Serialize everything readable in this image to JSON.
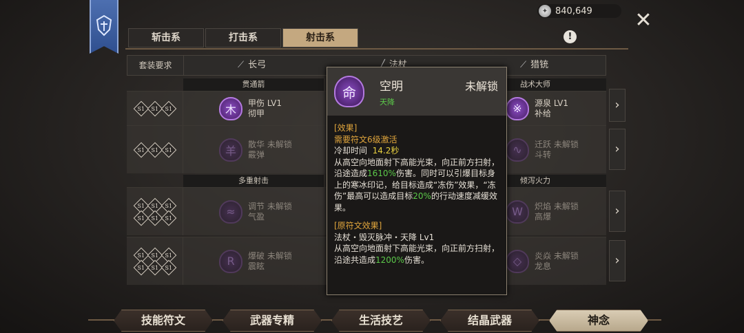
{
  "currency": {
    "icon": "silver-coin-icon",
    "amount": "840,649"
  },
  "tabs": [
    {
      "label": "斩击系",
      "active": false
    },
    {
      "label": "打击系",
      "active": false
    },
    {
      "label": "射击系",
      "active": true
    }
  ],
  "filter": {
    "label": "套装要求",
    "weapons": [
      {
        "icon": "bow-icon",
        "label": "长弓"
      },
      {
        "icon": "staff-icon",
        "label": "法杖"
      },
      {
        "icon": "musket-icon",
        "label": "猎铳"
      }
    ]
  },
  "groups": {
    "g1_left": "贯通箭",
    "g1_right": "战术大师",
    "g2_left": "多重射击",
    "g2_right": "倾泻火力"
  },
  "rows": [
    {
      "slots": [
        "S1",
        "S1",
        "S1"
      ],
      "left": {
        "name": "甲伤 LV1",
        "desc": "彻甲"
      },
      "right": {
        "name": "源泉 LV1",
        "desc": "补给"
      }
    },
    {
      "slots": [
        "S1",
        "S1",
        "S1"
      ],
      "left": {
        "name": "散华 未解锁",
        "desc": "霰弹"
      },
      "right": {
        "name": "迁跃 未解锁",
        "desc": "斗转"
      }
    },
    {
      "slots": [
        "S1",
        "S1",
        "S1",
        "S1",
        "S1",
        "S1"
      ],
      "left": {
        "name": "调节 未解锁",
        "desc": "气盈"
      },
      "right": {
        "name": "炽焰 未解锁",
        "desc": "高爆"
      }
    },
    {
      "slots": [
        "S1",
        "S1",
        "S1",
        "S1",
        "S1",
        "S1"
      ],
      "left": {
        "name": "爆破 未解锁",
        "desc": "震眩"
      },
      "right": {
        "name": "炎焱 未解锁",
        "desc": "龙息"
      }
    }
  ],
  "tooltip": {
    "name": "空明",
    "subtitle": "天降",
    "status": "未解锁",
    "effect_header": "[效果]",
    "requirement": "需要符文6级激活",
    "cooldown_label": "冷却时间",
    "cooldown_value": "14.2秒",
    "effect_pre": "从高空向地面射下高能光束，向正前方扫射，沿途造成",
    "effect_pct1": "1610%",
    "effect_mid": "伤害。同时可以引爆目标身上的寒冰印记，给目标造成“冻伤”效果，“冻伤”最高可以造成目标",
    "effect_pct2": "20%",
    "effect_post": "的行动速度减缓效果。",
    "orig_header": "[原符文效果]",
    "orig_source": "法杖・毁灭脉冲・天降 Lv1",
    "orig_pre": "从高空向地面射下高能光束，向正前方扫射，沿途共造成",
    "orig_pct": "1200%",
    "orig_post": "伤害。"
  },
  "bottom_nav": [
    {
      "label": "技能符文",
      "active": false
    },
    {
      "label": "武器专精",
      "active": false
    },
    {
      "label": "生活技艺",
      "active": false
    },
    {
      "label": "结晶武器",
      "active": false
    },
    {
      "label": "神念",
      "active": true
    }
  ]
}
